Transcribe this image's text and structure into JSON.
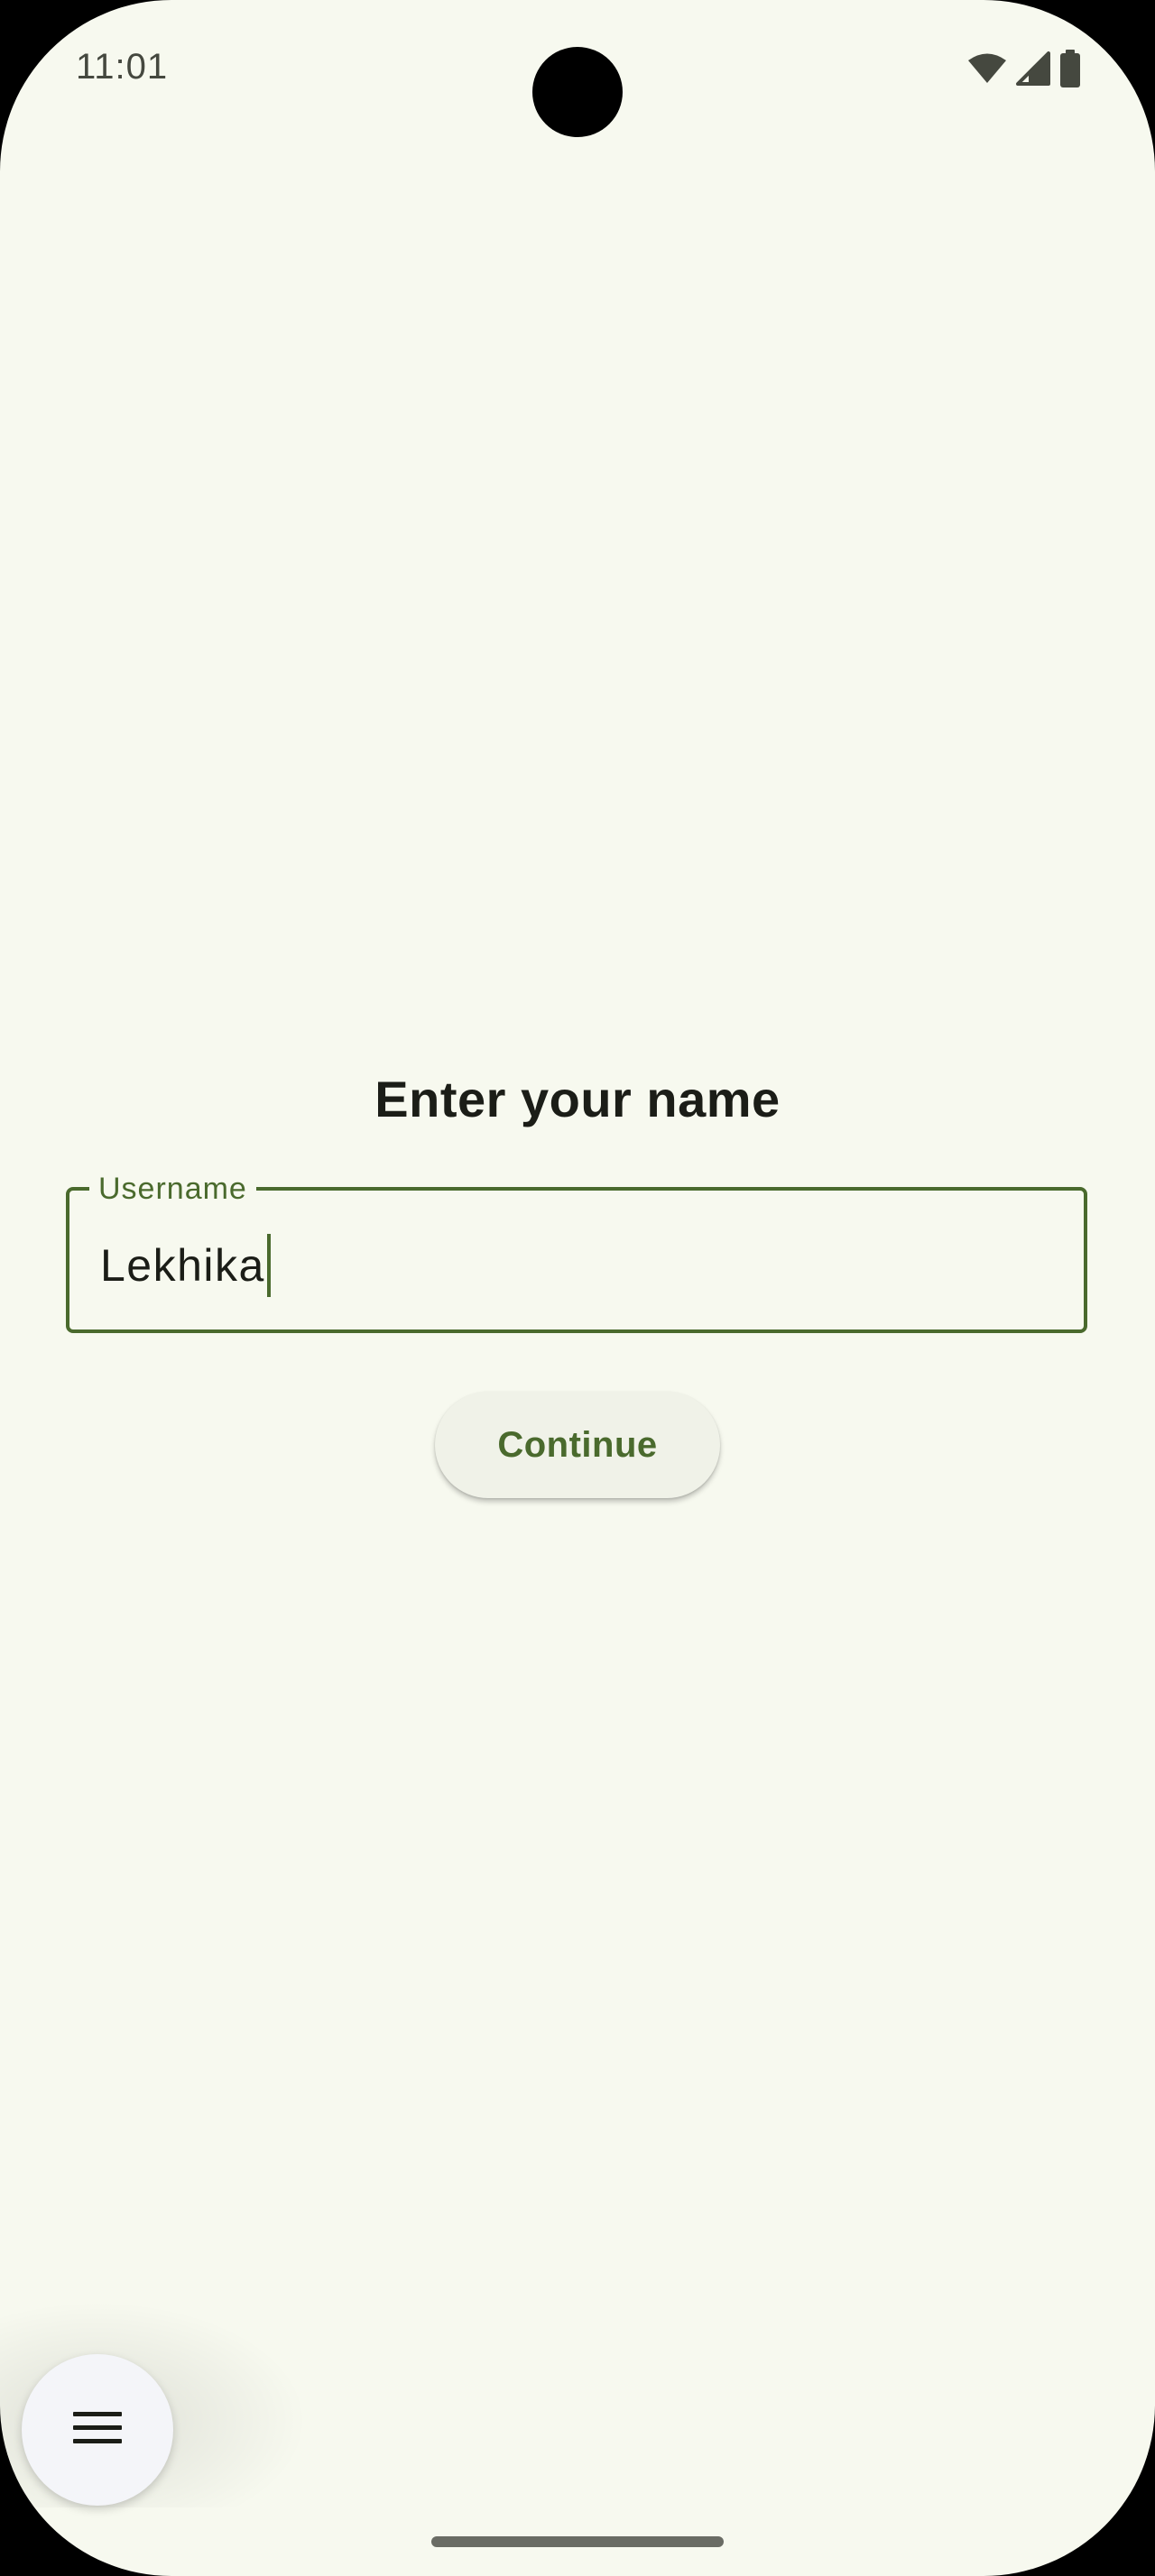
{
  "status_bar": {
    "time": "11:01",
    "icons": [
      "wifi-icon",
      "cellular-signal-icon",
      "battery-icon"
    ]
  },
  "screen": {
    "title": "Enter your name",
    "username_field": {
      "label": "Username",
      "value": "Lekhika"
    },
    "continue_button": {
      "label": "Continue"
    },
    "menu_button": {
      "icon": "menu-icon"
    }
  },
  "colors": {
    "background": "#f7f9ef",
    "accent": "#4a6a2d",
    "text": "#1b1d17",
    "button_surface": "#f0f2e8"
  }
}
